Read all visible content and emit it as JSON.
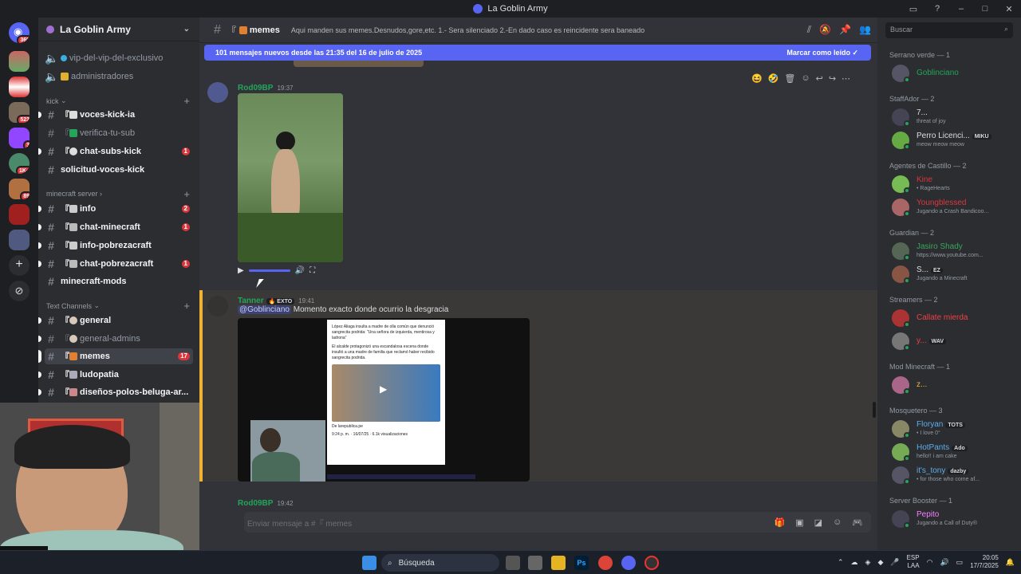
{
  "window": {
    "title": "La Goblin Army"
  },
  "guild_badges": [
    "369",
    "523",
    "3",
    "1K+",
    "89"
  ],
  "server": {
    "name": "La Goblin Army"
  },
  "channels_top": [
    {
      "label": "vip-del-vip-del-exclusivo"
    },
    {
      "label": "administradores"
    }
  ],
  "categories": {
    "kick": "kick",
    "minecraft": "minecraft server",
    "text": "Text Channels"
  },
  "kick_channels": [
    {
      "label": "voces-kick-ia",
      "bracket": "『",
      "badge": ""
    },
    {
      "label": "verifica-tu-sub",
      "bracket": "『",
      "badge": ""
    },
    {
      "label": "chat-subs-kick",
      "bracket": "『",
      "badge": "1"
    },
    {
      "label": "solicitud-voces-kick",
      "bracket": "",
      "badge": ""
    }
  ],
  "minecraft_channels": [
    {
      "label": "info",
      "bracket": "『",
      "badge": "2"
    },
    {
      "label": "chat-minecraft",
      "bracket": "『",
      "badge": "1"
    },
    {
      "label": "info-pobrezacraft",
      "bracket": "『",
      "badge": ""
    },
    {
      "label": "chat-pobrezacraft",
      "bracket": "『",
      "badge": "1"
    },
    {
      "label": "minecraft-mods",
      "bracket": "",
      "badge": ""
    }
  ],
  "text_channels": [
    {
      "label": "general",
      "bracket": "『",
      "badge": ""
    },
    {
      "label": "general-admins",
      "bracket": "『",
      "badge": ""
    },
    {
      "label": "memes",
      "bracket": "『",
      "badge": "17"
    },
    {
      "label": "ludopatia",
      "bracket": "『",
      "badge": ""
    },
    {
      "label": "diseños-polos-beluga-ar...",
      "bracket": "『",
      "badge": ""
    }
  ],
  "channel": {
    "name": "memes",
    "bracket": "『",
    "topic": "Aqui manden sus memes.Desnudos,gore,etc. 1.- Sera silenciado 2.-En dado caso es reincidente sera baneado"
  },
  "new_messages_bar": {
    "text": "101 mensajes nuevos desde las 21:35 del 16 de julio de 2025",
    "action": "Marcar como leído"
  },
  "messages": [
    {
      "author": "Rod09BP",
      "time": "19:37"
    },
    {
      "author": "Tanner",
      "tag": "EXTO",
      "time": "19:41",
      "mention": "@Goblinciano",
      "text": "Momento exacto donde ocurrio la desgracia"
    },
    {
      "author": "Rod09BP",
      "time": "19:42"
    }
  ],
  "embed_news": {
    "headline": "López Aliaga insulta a madre de olla común que denunció sangrecita podrida: \"Una señora de izquierda, mentirosa y ladrona\"",
    "body": "El alcalde protagonizó una escandalosa escena donde insultó a una madre de familia que reclamó haber recibido sangrecita podrida.",
    "source": "De larepublica.pe",
    "meta": "9:24 p. m. · 16/07/25 · 6.1k visualizaciones"
  },
  "input": {
    "placeholder": "Enviar mensaje a #『 memes"
  },
  "members": {
    "search_placeholder": "Buscar",
    "groups": [
      {
        "title": "Serrano verde — 1",
        "items": [
          {
            "name": "Goblinciano",
            "status": "",
            "color": "#23a55a",
            "tag": ""
          }
        ]
      },
      {
        "title": "StaffAdor — 2",
        "items": [
          {
            "name": "7...",
            "status": "threat of joy",
            "color": "#dbdee1",
            "tag": ""
          },
          {
            "name": "Perro Licenci...",
            "status": "meow meow meow",
            "color": "#dbdee1",
            "tag": "MIKU"
          }
        ]
      },
      {
        "title": "Agentes de Castillo — 2",
        "items": [
          {
            "name": "Kine",
            "status": "• RageHearts",
            "color": "#da373c",
            "tag": ""
          },
          {
            "name": "Youngblessed",
            "status": "Jugando a Crash Bandicoo...",
            "color": "#da373c",
            "tag": ""
          }
        ]
      },
      {
        "title": "Guardian — 2",
        "items": [
          {
            "name": "Jasiro Shady",
            "status": "https://www.youtube.com...",
            "color": "#3ba55c",
            "tag": ""
          },
          {
            "name": "S...",
            "status": "Jugando a Minecraft",
            "color": "#dbdee1",
            "tag": "EZ"
          }
        ]
      },
      {
        "title": "Streamers — 2",
        "items": [
          {
            "name": "Callate mierda",
            "status": "",
            "color": "#f23f43",
            "tag": ""
          },
          {
            "name": "y...",
            "status": "",
            "color": "#f23f43",
            "tag": "WAV"
          }
        ]
      },
      {
        "title": "Mod Minecraft — 1",
        "items": [
          {
            "name": "z...",
            "status": "",
            "color": "#f0b232",
            "tag": ""
          }
        ]
      },
      {
        "title": "Mosquetero — 3",
        "items": [
          {
            "name": "Floryan",
            "status": "• I love 0°",
            "color": "#5dadec",
            "tag": "TOTS"
          },
          {
            "name": "HotPants",
            "status": "hello!! i am cake",
            "color": "#5dadec",
            "tag": "Ado"
          },
          {
            "name": "it's_tony",
            "status": "• for those who come af...",
            "color": "#5dadec",
            "tag": "dazby"
          }
        ]
      },
      {
        "title": "Server Booster — 1",
        "items": [
          {
            "name": "Pepito",
            "status": "Jugando a Call of Duty®",
            "color": "#f47fff",
            "tag": ""
          }
        ]
      }
    ]
  },
  "taskbar": {
    "search": "Búsqueda",
    "lang1": "ESP",
    "lang2": "LAA",
    "time": "20:05",
    "date": "17/7/2025"
  },
  "colors": {
    "accent": "#5865f2",
    "danger": "#da373c",
    "online": "#23a55a"
  }
}
